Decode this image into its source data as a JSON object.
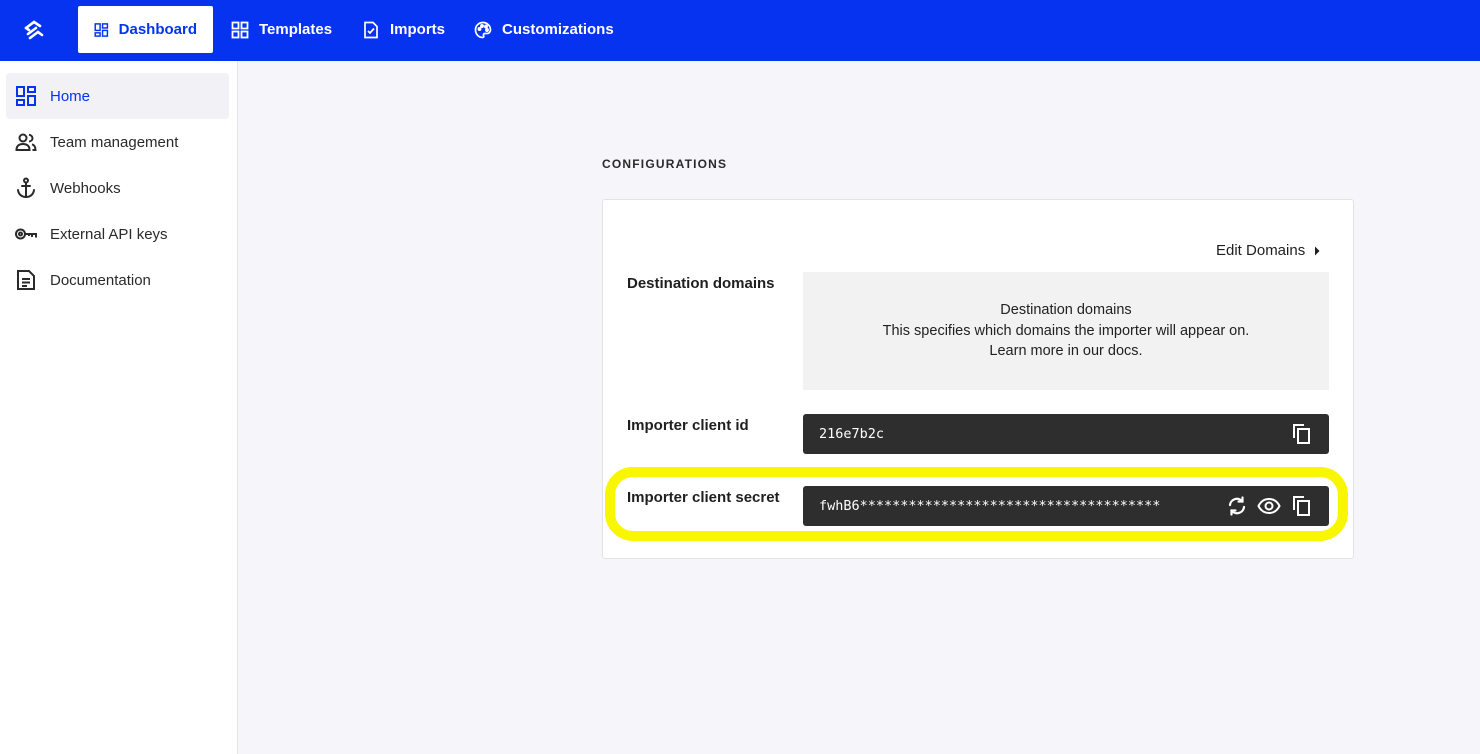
{
  "topbar": {
    "logo_icon": "brand-logo-icon",
    "tabs": [
      {
        "label": "Dashboard",
        "icon": "dashboard-icon",
        "active": true
      },
      {
        "label": "Templates",
        "icon": "grid-icon",
        "active": false
      },
      {
        "label": "Imports",
        "icon": "file-check-icon",
        "active": false
      },
      {
        "label": "Customizations",
        "icon": "palette-icon",
        "active": false
      }
    ]
  },
  "sidebar": {
    "items": [
      {
        "label": "Home",
        "icon": "dashboard-icon",
        "active": true
      },
      {
        "label": "Team management",
        "icon": "team-icon",
        "active": false
      },
      {
        "label": "Webhooks",
        "icon": "anchor-icon",
        "active": false
      },
      {
        "label": "External API keys",
        "icon": "key-icon",
        "active": false
      },
      {
        "label": "Documentation",
        "icon": "document-icon",
        "active": false
      }
    ]
  },
  "main": {
    "section_title": "CONFIGURATIONS",
    "edit_domains_label": "Edit Domains",
    "destination_domains": {
      "label": "Destination domains",
      "empty_title": "Destination domains",
      "empty_desc": "This specifies which domains the importer will appear on.",
      "empty_link": "Learn more in our docs."
    },
    "client_id": {
      "label": "Importer client id",
      "value": "216e7b2c"
    },
    "client_secret": {
      "label": "Importer client secret",
      "value": "fwhB6*************************************"
    }
  },
  "colors": {
    "brand_blue": "#0633f0",
    "highlight_yellow": "#f8f600",
    "field_dark": "#2e2e2e"
  }
}
